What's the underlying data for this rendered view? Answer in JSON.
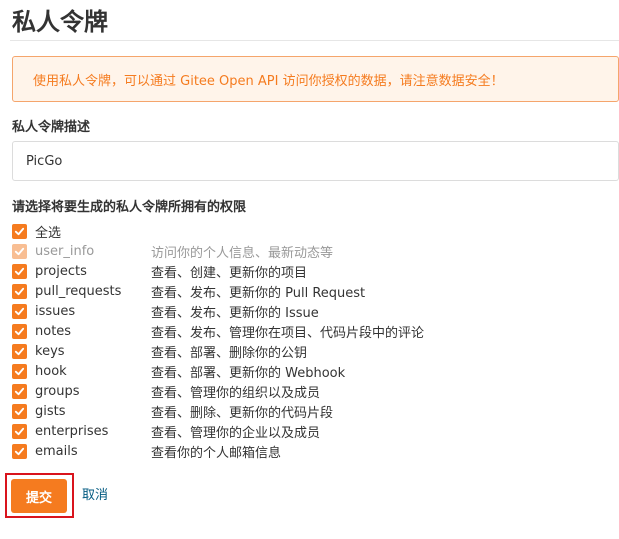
{
  "page": {
    "title": "私人令牌"
  },
  "warning": {
    "text": "使用私人令牌，可以通过 Gitee Open API 访问你授权的数据，请注意数据安全！"
  },
  "form": {
    "description_label": "私人令牌描述",
    "description_value": "PicGo",
    "permissions_label": "请选择将要生成的私人令牌所拥有的权限",
    "select_all_label": "全选",
    "permissions": [
      {
        "name": "user_info",
        "desc": "访问你的个人信息、最新动态等",
        "checked": true,
        "disabled": true
      },
      {
        "name": "projects",
        "desc": "查看、创建、更新你的项目",
        "checked": true,
        "disabled": false
      },
      {
        "name": "pull_requests",
        "desc": "查看、发布、更新你的 Pull Request",
        "checked": true,
        "disabled": false
      },
      {
        "name": "issues",
        "desc": "查看、发布、更新你的 Issue",
        "checked": true,
        "disabled": false
      },
      {
        "name": "notes",
        "desc": "查看、发布、管理你在项目、代码片段中的评论",
        "checked": true,
        "disabled": false
      },
      {
        "name": "keys",
        "desc": "查看、部署、删除你的公钥",
        "checked": true,
        "disabled": false
      },
      {
        "name": "hook",
        "desc": "查看、部署、更新你的 Webhook",
        "checked": true,
        "disabled": false
      },
      {
        "name": "groups",
        "desc": "查看、管理你的组织以及成员",
        "checked": true,
        "disabled": false
      },
      {
        "name": "gists",
        "desc": "查看、删除、更新你的代码片段",
        "checked": true,
        "disabled": false
      },
      {
        "name": "enterprises",
        "desc": "查看、管理你的企业以及成员",
        "checked": true,
        "disabled": false
      },
      {
        "name": "emails",
        "desc": "查看你的个人邮箱信息",
        "checked": true,
        "disabled": false
      }
    ]
  },
  "actions": {
    "submit_label": "提交",
    "cancel_label": "取消"
  },
  "colors": {
    "accent": "#f57b1f",
    "accent_disabled": "#f8be93",
    "warning_bg": "#fff4ea",
    "warning_border": "#f5a56c",
    "link": "#005980",
    "highlight": "#d9141d"
  },
  "icons": {
    "checkbox": "check-icon"
  }
}
